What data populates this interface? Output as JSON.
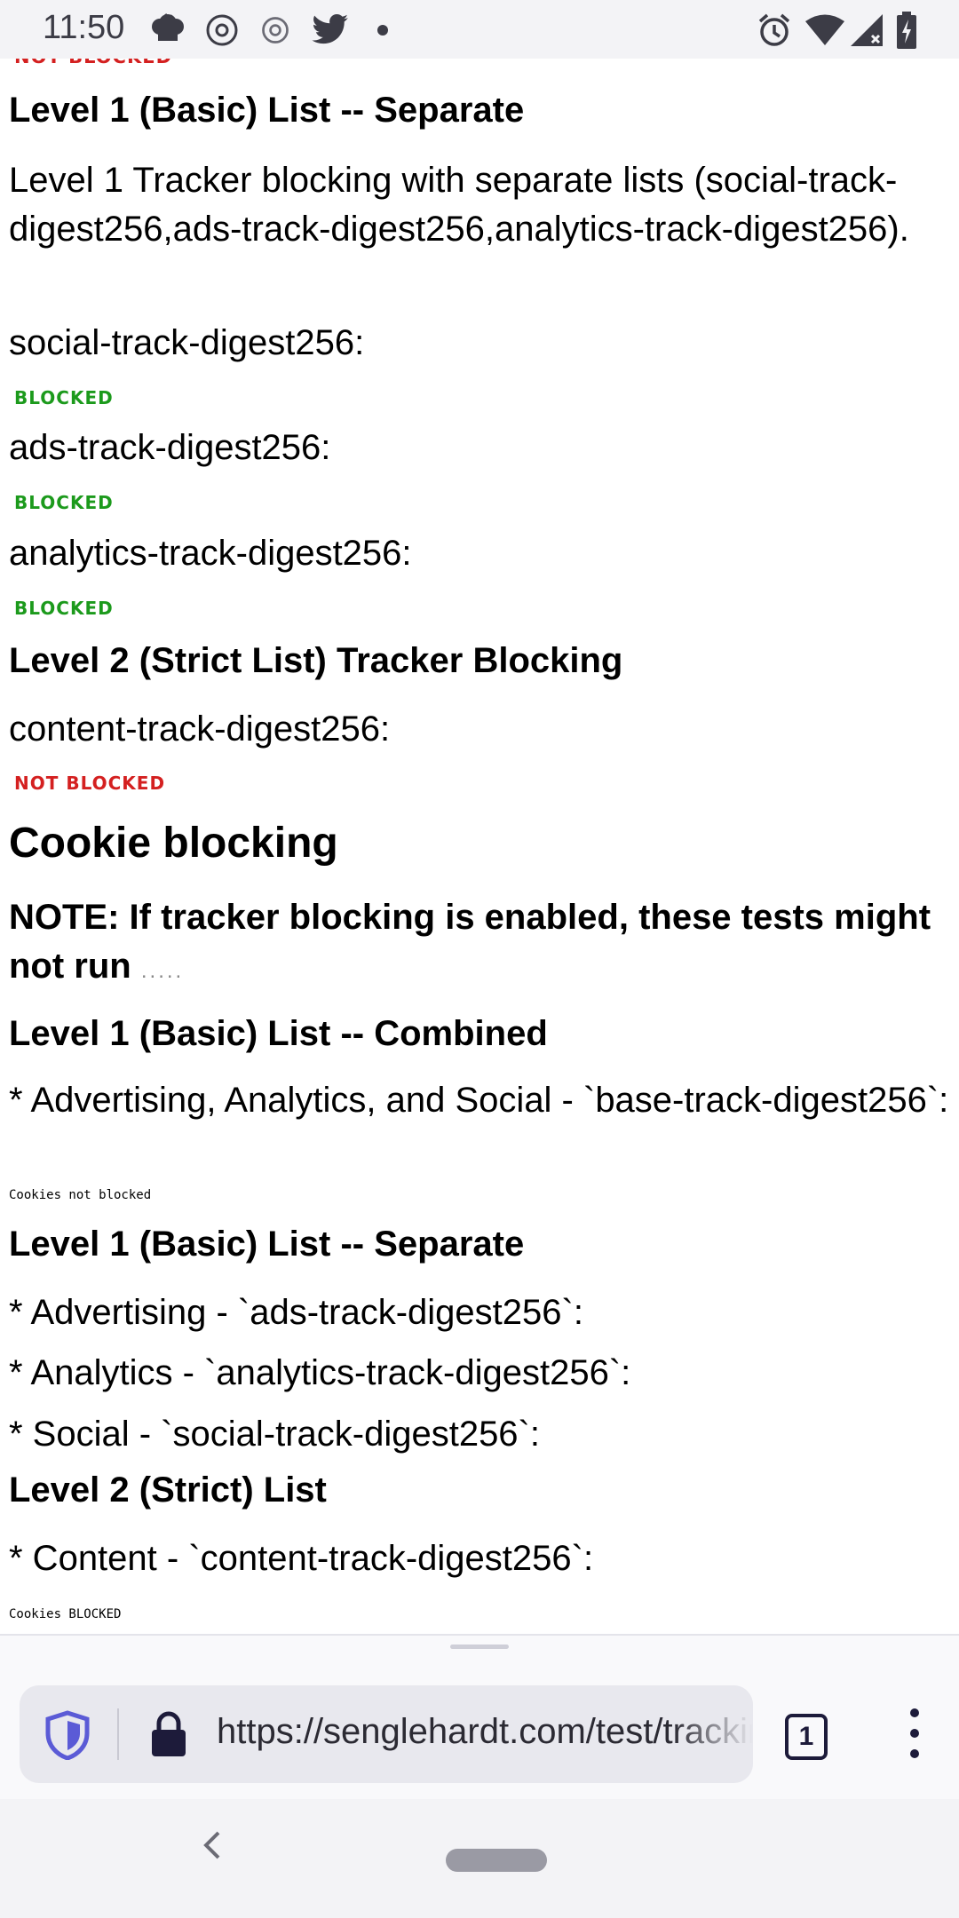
{
  "status_bar": {
    "time": "11:50",
    "left_icons": [
      "chef-hat-icon",
      "at-sign-icon",
      "at-sign-icon",
      "twitter-icon",
      "dot-icon"
    ],
    "right_icons": [
      "alarm-icon",
      "wifi-icon",
      "cell-signal-icon",
      "battery-charging-icon"
    ]
  },
  "page": {
    "cut_off_tag": "NOT BLOCKED",
    "tracker_level1_separate": {
      "heading": "Level 1 (Basic) List -- Separate",
      "description": "Level 1 Tracker blocking with separate lists (social-track-digest256,ads-track-digest256,analytics-track-digest256).",
      "items": [
        {
          "label": "social-track-digest256:",
          "status": "BLOCKED"
        },
        {
          "label": "ads-track-digest256:",
          "status": "BLOCKED"
        },
        {
          "label": "analytics-track-digest256:",
          "status": "BLOCKED"
        }
      ]
    },
    "tracker_level2": {
      "heading": "Level 2 (Strict List) Tracker Blocking",
      "items": [
        {
          "label": "content-track-digest256:",
          "status": "NOT BLOCKED"
        }
      ]
    },
    "cookie_section": {
      "heading": "Cookie blocking",
      "note": "NOTE: If tracker blocking is enabled, these tests might not run",
      "note_dots": ".....",
      "combined": {
        "heading": "Level 1 (Basic) List -- Combined",
        "item": "* Advertising, Analytics, and Social - `base-track-digest256`:",
        "result": "Cookies not blocked"
      },
      "separate": {
        "heading": "Level 1 (Basic) List -- Separate",
        "items": [
          "* Advertising - `ads-track-digest256`:",
          "* Analytics - `analytics-track-digest256`:",
          "* Social - `social-track-digest256`:"
        ]
      },
      "strict": {
        "heading": "Level 2 (Strict) List",
        "item": "* Content - `content-track-digest256`:",
        "result": "Cookies BLOCKED"
      }
    }
  },
  "toolbar": {
    "url": "https://senglehardt.com/test/trackingprotection",
    "tab_count": "1"
  },
  "colors": {
    "blocked": "#1c9a1c",
    "not_blocked": "#d42020",
    "icon_dark": "#1d1b3a"
  }
}
